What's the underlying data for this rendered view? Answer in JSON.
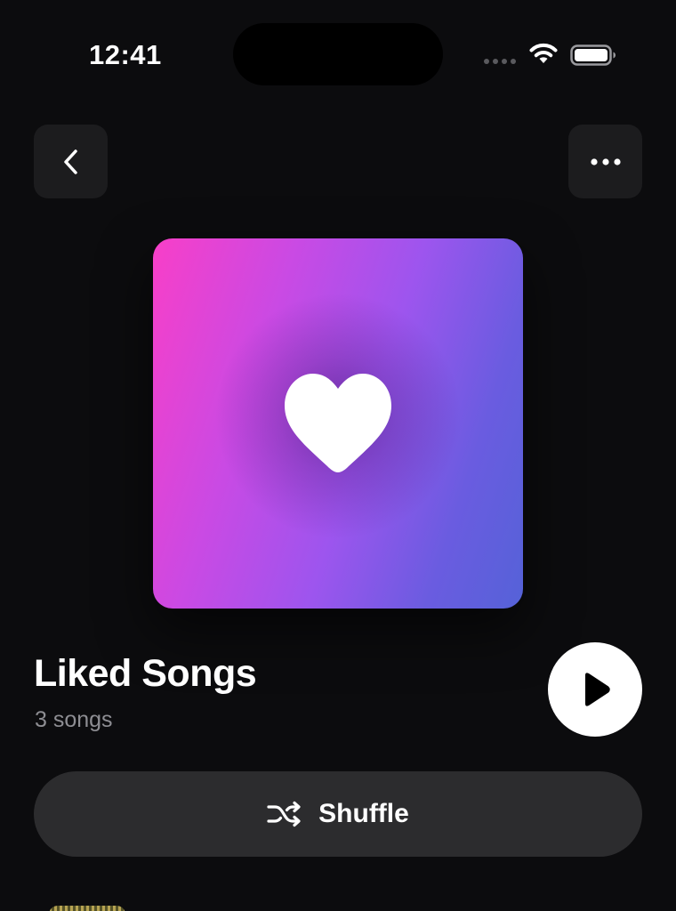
{
  "status_bar": {
    "time": "12:41",
    "icons": [
      "cellular-signal-icon",
      "wifi-icon",
      "battery-icon"
    ]
  },
  "navigation": {
    "back_icon": "chevron-left-icon",
    "more_icon": "ellipsis-icon"
  },
  "playlist": {
    "artwork_icon": "heart-icon",
    "artwork_colors": [
      "#f83fc8",
      "#9d55ee",
      "#5562d8"
    ],
    "title": "Liked Songs",
    "song_count": "3 songs"
  },
  "actions": {
    "play_icon": "play-icon",
    "shuffle_label": "Shuffle",
    "shuffle_icon": "shuffle-icon"
  },
  "colors": {
    "background": "#0c0c0e",
    "button_bg": "#1c1c1e",
    "shuffle_bg": "#2c2c2e",
    "secondary_text": "#8e8e93"
  }
}
